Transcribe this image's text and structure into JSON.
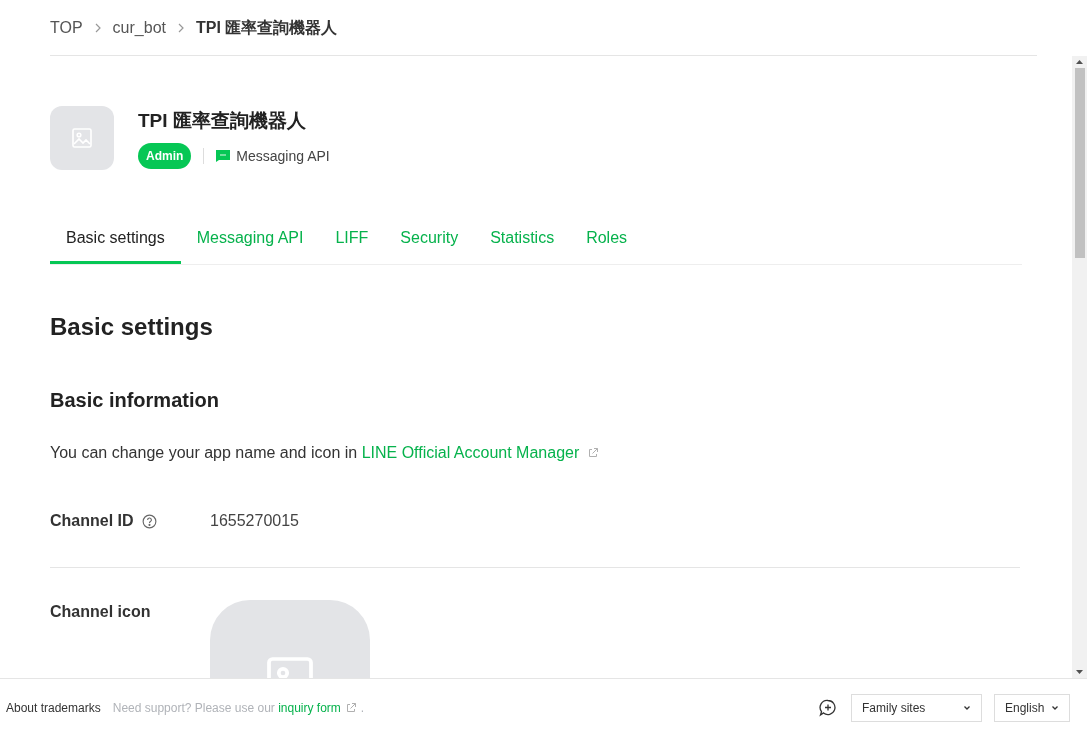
{
  "breadcrumb": [
    {
      "label": "TOP",
      "current": false
    },
    {
      "label": "cur_bot",
      "current": false
    },
    {
      "label": "TPI 匯率查詢機器人",
      "current": true
    }
  ],
  "channel": {
    "name": "TPI 匯率查詢機器人",
    "role": "Admin",
    "type": "Messaging API"
  },
  "tabs": [
    {
      "label": "Basic settings",
      "selected": true
    },
    {
      "label": "Messaging API",
      "selected": false
    },
    {
      "label": "LIFF",
      "selected": false
    },
    {
      "label": "Security",
      "selected": false
    },
    {
      "label": "Statistics",
      "selected": false
    },
    {
      "label": "Roles",
      "selected": false
    }
  ],
  "page_title": "Basic settings",
  "section_title": "Basic information",
  "info": {
    "text": "You can change your app name and icon in",
    "link": "LINE Official Account Manager"
  },
  "fields": [
    {
      "kind": "text",
      "label": "Channel ID",
      "help": true,
      "value": "1655270015"
    },
    {
      "kind": "image",
      "label": "Channel icon",
      "help": false
    }
  ],
  "footer": {
    "trademarks": "About trademarks",
    "support": {
      "text": "Need support? Please use our",
      "link": "inquiry form",
      "suffix": "."
    },
    "selects": [
      "Family sites",
      "English"
    ]
  }
}
